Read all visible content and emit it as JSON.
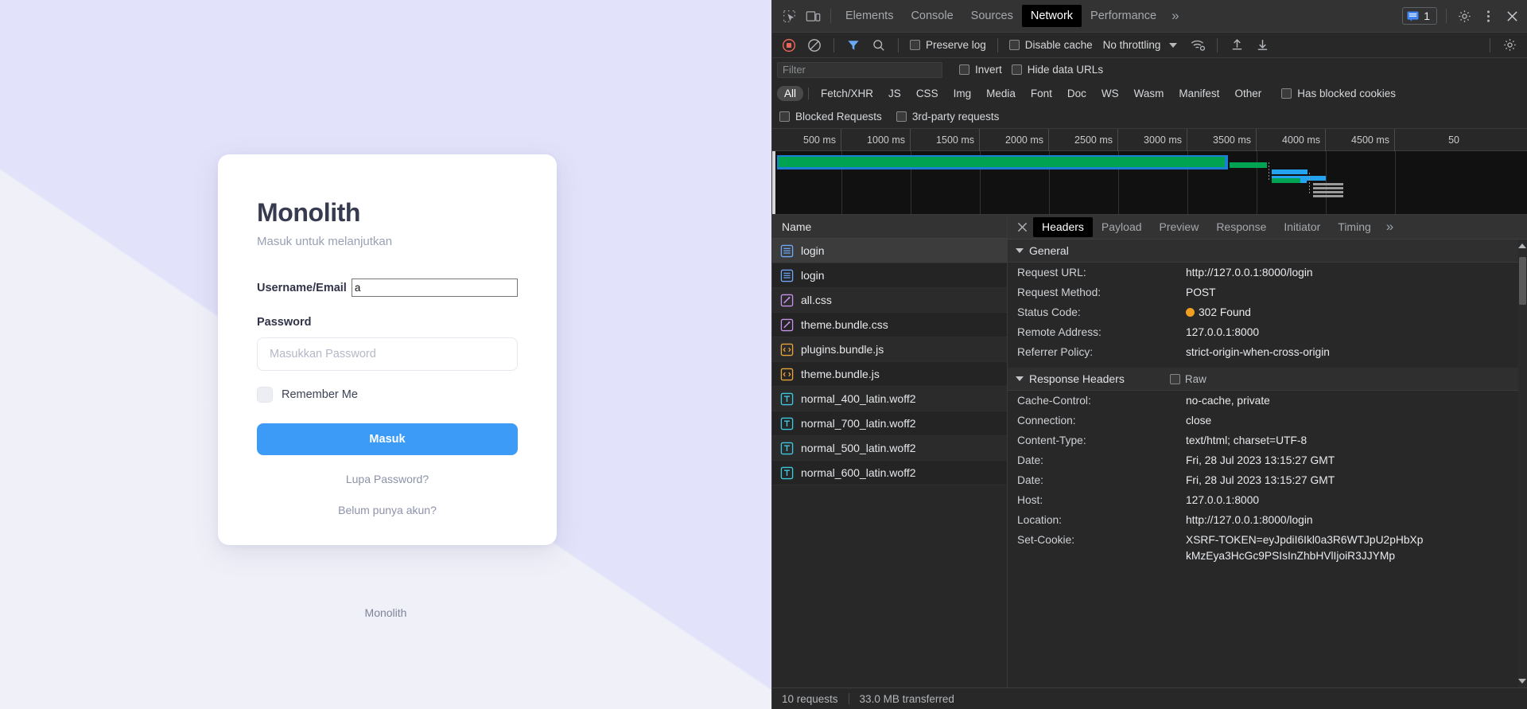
{
  "page": {
    "brand_title": "Monolith",
    "subtitle": "Masuk untuk melanjutkan",
    "username_label": "Username/Email",
    "username_value": "a",
    "password_label": "Password",
    "password_placeholder": "Masukkan Password",
    "remember_label": "Remember Me",
    "submit_label": "Masuk",
    "forgot_link": "Lupa Password?",
    "register_link": "Belum punya akun?",
    "footer": "Monolith",
    "accent_color": "#3b9bf7",
    "background_color": "#e2e2fa"
  },
  "devtools": {
    "tabs": [
      "Elements",
      "Console",
      "Sources",
      "Network",
      "Performance"
    ],
    "active_tab": "Network",
    "more_tabs": "»",
    "message_count": "1",
    "toolbar": {
      "preserve_log": "Preserve log",
      "disable_cache": "Disable cache",
      "throttling": "No throttling"
    },
    "filter": {
      "placeholder": "Filter",
      "value": "",
      "invert": "Invert",
      "hide_data_urls": "Hide data URLs"
    },
    "type_chips": [
      "All",
      "Fetch/XHR",
      "JS",
      "CSS",
      "Img",
      "Media",
      "Font",
      "Doc",
      "WS",
      "Wasm",
      "Manifest",
      "Other"
    ],
    "active_chip": "All",
    "has_blocked_cookies": "Has blocked cookies",
    "blocked_requests": "Blocked Requests",
    "third_party_requests": "3rd-party requests",
    "timeline": {
      "ticks": [
        "500 ms",
        "1000 ms",
        "1500 ms",
        "2000 ms",
        "2500 ms",
        "3000 ms",
        "3500 ms",
        "4000 ms",
        "4500 ms",
        "50"
      ]
    },
    "requests": {
      "column_header": "Name",
      "rows": [
        {
          "name": "login",
          "type": "doc",
          "selected": true
        },
        {
          "name": "login",
          "type": "doc",
          "selected": false
        },
        {
          "name": "all.css",
          "type": "css",
          "selected": false
        },
        {
          "name": "theme.bundle.css",
          "type": "css",
          "selected": false
        },
        {
          "name": "plugins.bundle.js",
          "type": "js",
          "selected": false
        },
        {
          "name": "theme.bundle.js",
          "type": "js",
          "selected": false
        },
        {
          "name": "normal_400_latin.woff2",
          "type": "font",
          "selected": false
        },
        {
          "name": "normal_700_latin.woff2",
          "type": "font",
          "selected": false
        },
        {
          "name": "normal_500_latin.woff2",
          "type": "font",
          "selected": false
        },
        {
          "name": "normal_600_latin.woff2",
          "type": "font",
          "selected": false
        }
      ]
    },
    "detail_tabs": [
      "Headers",
      "Payload",
      "Preview",
      "Response",
      "Initiator",
      "Timing"
    ],
    "detail_active_tab": "Headers",
    "detail_more": "»",
    "general": {
      "section_title": "General",
      "rows": [
        {
          "key": "Request URL:",
          "value": "http://127.0.0.1:8000/login"
        },
        {
          "key": "Request Method:",
          "value": "POST"
        },
        {
          "key": "Status Code:",
          "value": "302 Found",
          "dot": "#f0a020"
        },
        {
          "key": "Remote Address:",
          "value": "127.0.0.1:8000"
        },
        {
          "key": "Referrer Policy:",
          "value": "strict-origin-when-cross-origin"
        }
      ]
    },
    "response_headers": {
      "section_title": "Response Headers",
      "raw_label": "Raw",
      "rows": [
        {
          "key": "Cache-Control:",
          "value": "no-cache, private"
        },
        {
          "key": "Connection:",
          "value": "close"
        },
        {
          "key": "Content-Type:",
          "value": "text/html; charset=UTF-8"
        },
        {
          "key": "Date:",
          "value": "Fri, 28 Jul 2023 13:15:27 GMT"
        },
        {
          "key": "Date:",
          "value": "Fri, 28 Jul 2023 13:15:27 GMT"
        },
        {
          "key": "Host:",
          "value": "127.0.0.1:8000"
        },
        {
          "key": "Location:",
          "value": "http://127.0.0.1:8000/login"
        },
        {
          "key": "Set-Cookie:",
          "value": "XSRF-TOKEN=eyJpdiI6Ikl0a3R6WTJpU2pHbXpkMzEya3HcGc9PSIsInZhbHVlIjoiR3JJYMp"
        }
      ]
    },
    "status_bar": {
      "requests": "10 requests",
      "transferred": "33.0 MB transferred"
    }
  }
}
